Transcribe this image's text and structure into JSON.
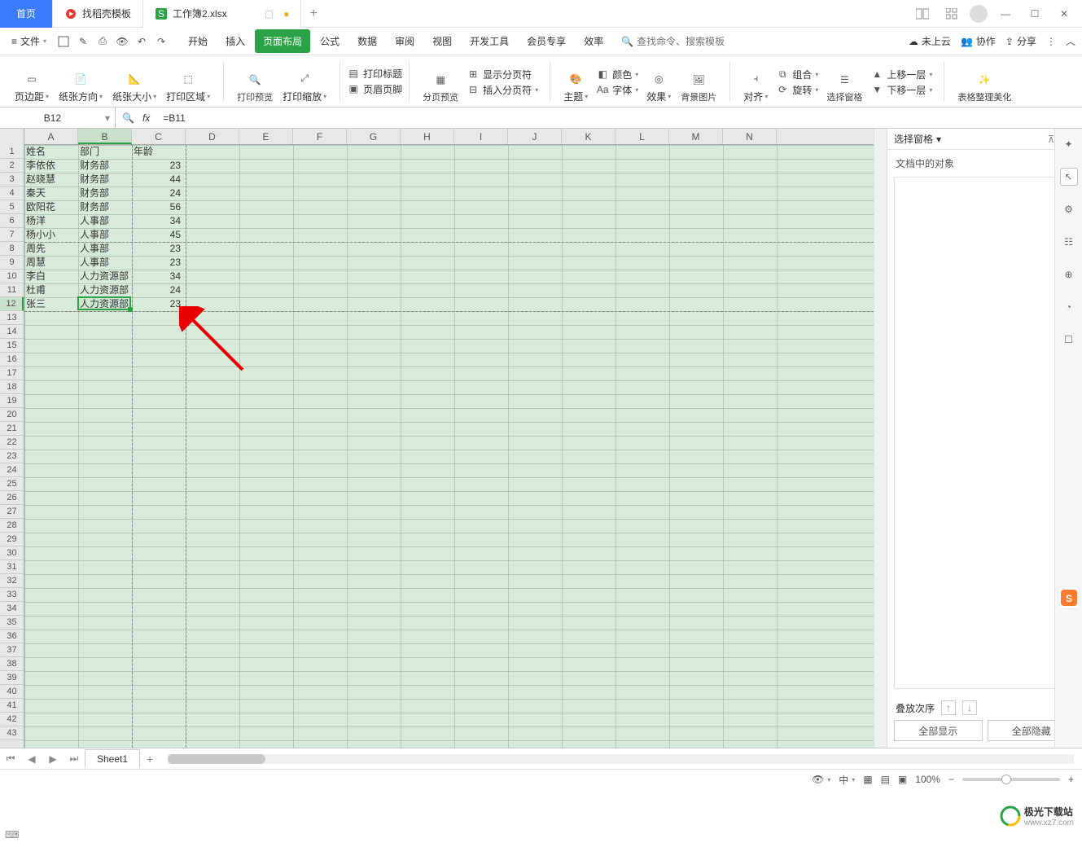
{
  "tabs": {
    "home": "首页",
    "template": "找稻壳模板",
    "file": "工作簿2.xlsx"
  },
  "menu": {
    "file": "文件",
    "tabs": [
      "开始",
      "插入",
      "页面布局",
      "公式",
      "数据",
      "审阅",
      "视图",
      "开发工具",
      "会员专享",
      "效率"
    ],
    "activeTab": "页面布局",
    "search_placeholder": "查找命令、搜索模板",
    "right": {
      "cloud": "未上云",
      "coop": "协作",
      "share": "分享"
    }
  },
  "ribbon": {
    "margins": "页边距",
    "orientation": "纸张方向",
    "size": "纸张大小",
    "printarea": "打印区域",
    "preview": "打印预览",
    "scale": "打印缩放",
    "titles": "打印标题",
    "headfoot": "页眉页脚",
    "pagebreak": "分页预览",
    "showbreak": "显示分页符",
    "insertbreak": "插入分页符",
    "theme": "主题",
    "colors": "颜色",
    "fonts": "字体",
    "effects": "效果",
    "bgimg": "背景图片",
    "align": "对齐",
    "group": "组合",
    "rotate": "旋转",
    "selpane": "选择窗格",
    "forward": "上移一层",
    "backward": "下移一层",
    "beautify": "表格整理美化"
  },
  "namebox": "B12",
  "formula": "=B11",
  "columns": [
    "A",
    "B",
    "C",
    "D",
    "E",
    "F",
    "G",
    "H",
    "I",
    "J",
    "K",
    "L",
    "M",
    "N"
  ],
  "selectedCol": "B",
  "selectedRow": 12,
  "rowCount": 43,
  "sheetdata": {
    "headers": [
      "姓名",
      "部门",
      "年龄"
    ],
    "rows": [
      [
        "李依依",
        "财务部",
        "23"
      ],
      [
        "赵晓慧",
        "财务部",
        "44"
      ],
      [
        "秦天",
        "财务部",
        "24"
      ],
      [
        "欧阳花",
        "财务部",
        "56"
      ],
      [
        "杨洋",
        "人事部",
        "34"
      ],
      [
        "杨小小",
        "人事部",
        "45"
      ],
      [
        "周先",
        "人事部",
        "23"
      ],
      [
        "周慧",
        "人事部",
        "23"
      ],
      [
        "李白",
        "人力资源部",
        "34"
      ],
      [
        "杜甫",
        "人力资源部",
        "24"
      ],
      [
        "张三",
        "人力资源部",
        "23"
      ]
    ]
  },
  "pane": {
    "title": "选择窗格",
    "subtitle": "文档中的对象",
    "order": "叠放次序",
    "showall": "全部显示",
    "hideall": "全部隐藏"
  },
  "sheettab": "Sheet1",
  "zoom": "100%",
  "watermark": {
    "main": "极光下载站",
    "sub": "www.xz7.com"
  }
}
